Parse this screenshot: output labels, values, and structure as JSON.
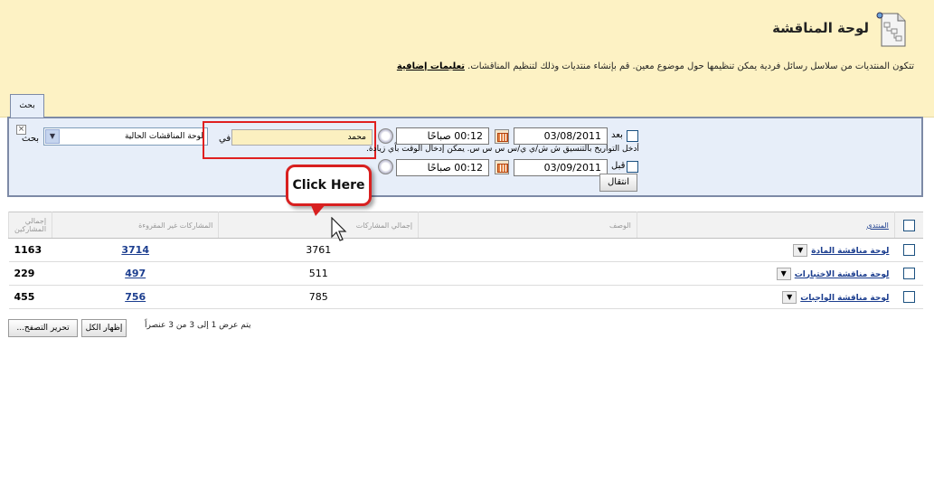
{
  "header": {
    "title": "لوحة المناقشة",
    "description": "تتكون المنتديات من سلاسل رسائل فردية يمكن تنظيمها حول موضوع معين. قم بإنشاء منتديات وذلك لتنظيم المناقشات.",
    "more_link": "تعليمات إضافية"
  },
  "search": {
    "tab_label": "بحث",
    "search_label": "بحث",
    "scope_value": "لوحة المناقشات الحالية",
    "in_label": "في",
    "query_value": "محمد",
    "after_label": "بعد",
    "before_label": "قبل",
    "after_date": "03/08/2011",
    "after_time": "00:12 صباحًا",
    "before_date": "03/09/2011",
    "before_time": "00:12 صباحًا",
    "hint": "أدخل التواريخ بالتنسيق ش ش/ي ي/س س س س. يمكن إدخال الوقت بأي زيادة.",
    "go_label": "انتقال"
  },
  "callout": {
    "text": "Click Here"
  },
  "table": {
    "columns": [
      "المنتدى",
      "الوصف",
      "إجمالي المشاركات",
      "المشاركات غير المقروءة",
      "إجمالي المشاركين"
    ],
    "rows": [
      {
        "forum": "لوحة مناقشة المادة",
        "total": "3761",
        "unread": "3714",
        "participants": "1163"
      },
      {
        "forum": "لوحة مناقشة الاختبارات",
        "total": "511",
        "unread": "497",
        "participants": "229"
      },
      {
        "forum": "لوحة مناقشة الواجبات",
        "total": "785",
        "unread": "756",
        "participants": "455"
      }
    ]
  },
  "footer": {
    "status": "يتم عرض 1 إلى 3 من 3 عنصراً",
    "show_all": "إظهار الكل",
    "edit_paging": "تحرير التصفح..."
  },
  "colors": {
    "header_bg": "#fdf2c4",
    "panel_bg": "#e7eef9",
    "highlight": "#e02020",
    "link": "#1c3e8f"
  }
}
